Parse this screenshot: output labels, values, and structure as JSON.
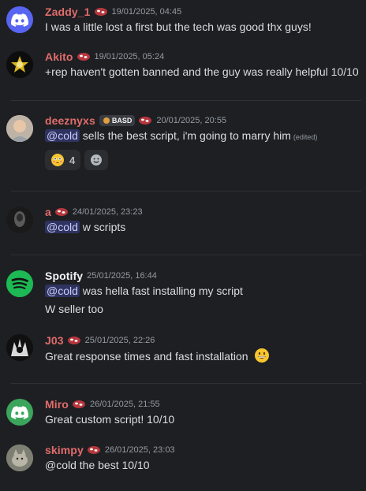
{
  "colors": {
    "background": "#1e1f22",
    "mention_bg": "#5865f2",
    "timestamp": "#949ba4",
    "username_red": "#e06c6c",
    "username_white": "#f2f3f5"
  },
  "messages": [
    {
      "username": "Zaddy_1",
      "username_color": "#e06c6c",
      "has_clan_badge": true,
      "timestamp": "19/01/2025, 04:45",
      "avatar_icon": "discord-logo-icon",
      "lines": [
        "I was a little lost a first but the tech was good thx guys!"
      ]
    },
    {
      "username": "Akito",
      "username_color": "#e06c6c",
      "has_clan_badge": true,
      "timestamp": "19/01/2025, 05:24",
      "avatar_icon": "user-avatar-image",
      "lines": [
        "+rep haven't gotten banned and the guy was really helpful 10/10"
      ]
    },
    {
      "username": "deeznyxs",
      "username_color": "#e06c6c",
      "tag": "BASD",
      "has_clan_badge": true,
      "timestamp": "20/01/2025, 20:55",
      "avatar_icon": "user-avatar-image",
      "mention": "@cold",
      "text_after_mention": "sells the best script, i'm going to marry him",
      "edited_label": "(edited)",
      "reaction_count": "4"
    },
    {
      "username": "a",
      "username_color": "#e06c6c",
      "has_clan_badge": true,
      "timestamp": "24/01/2025, 23:23",
      "avatar_icon": "user-avatar-image",
      "mention": "@cold",
      "text_after_mention": "w scripts"
    },
    {
      "username": "Spotify",
      "username_color": "#f2f3f5",
      "has_clan_badge": false,
      "timestamp": "25/01/2025, 16:44",
      "avatar_icon": "spotify-logo-icon",
      "mention": "@cold",
      "text_after_mention": "was hella fast installing my script",
      "second_line": "W seller too"
    },
    {
      "username": "J03",
      "username_color": "#e06c6c",
      "has_clan_badge": true,
      "timestamp": "25/01/2025, 22:26",
      "avatar_icon": "user-avatar-image",
      "lines": [
        "Great response times and fast installation"
      ]
    },
    {
      "username": "Miro",
      "username_color": "#e06c6c",
      "has_clan_badge": true,
      "timestamp": "26/01/2025, 21:55",
      "avatar_icon": "discord-logo-icon",
      "lines": [
        "Great custom script! 10/10"
      ]
    },
    {
      "username": "skimpy",
      "username_color": "#e06c6c",
      "has_clan_badge": true,
      "timestamp": "26/01/2025, 23:03",
      "avatar_icon": "user-avatar-image",
      "lines": [
        "@cold the best 10/10"
      ]
    }
  ]
}
